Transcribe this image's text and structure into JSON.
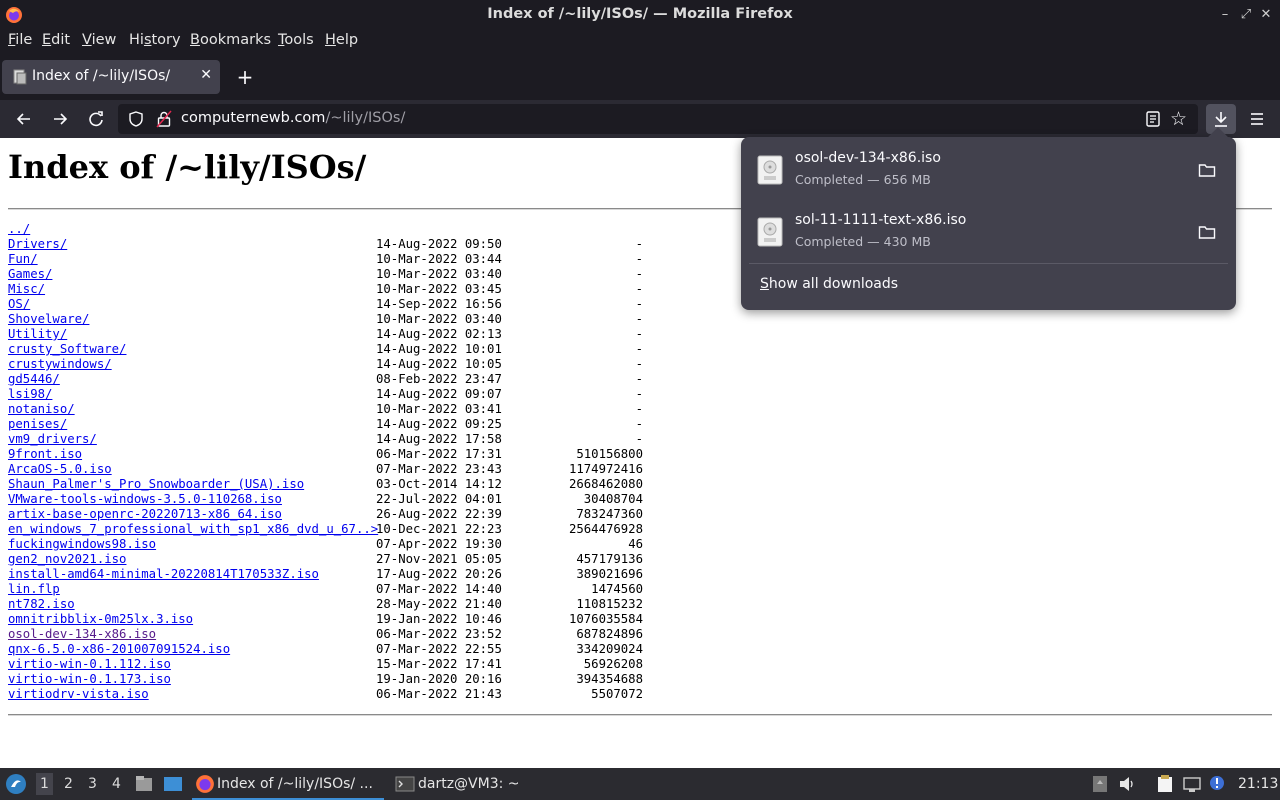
{
  "window": {
    "title": "Index of /~lily/ISOs/ — Mozilla Firefox"
  },
  "menubar": [
    {
      "label": "File",
      "accel": "F",
      "rest": "ile"
    },
    {
      "label": "Edit",
      "accel": "E",
      "rest": "dit"
    },
    {
      "label": "View",
      "accel": "V",
      "rest": "iew"
    },
    {
      "label": "History",
      "accel": "s",
      "pre": "Hi",
      "rest": "tory"
    },
    {
      "label": "Bookmarks",
      "accel": "B",
      "rest": "ookmarks"
    },
    {
      "label": "Tools",
      "accel": "T",
      "rest": "ools"
    },
    {
      "label": "Help",
      "accel": "H",
      "rest": "elp"
    }
  ],
  "tab": {
    "title": "Index of /~lily/ISOs/",
    "close": "✕"
  },
  "newtab": "+",
  "urlbar": {
    "host": "computernewb.com",
    "path": "/~lily/ISOs/"
  },
  "page": {
    "heading": "Index of /~lily/ISOs/",
    "parent": "../",
    "entries": [
      {
        "name": "Drivers/",
        "date": "14-Aug-2022 09:50",
        "size": "-"
      },
      {
        "name": "Fun/",
        "date": "10-Mar-2022 03:44",
        "size": "-"
      },
      {
        "name": "Games/",
        "date": "10-Mar-2022 03:40",
        "size": "-"
      },
      {
        "name": "Misc/",
        "date": "10-Mar-2022 03:45",
        "size": "-"
      },
      {
        "name": "OS/",
        "date": "14-Sep-2022 16:56",
        "size": "-"
      },
      {
        "name": "Shovelware/",
        "date": "10-Mar-2022 03:40",
        "size": "-"
      },
      {
        "name": "Utility/",
        "date": "14-Aug-2022 02:13",
        "size": "-"
      },
      {
        "name": "crusty_Software/",
        "date": "14-Aug-2022 10:01",
        "size": "-"
      },
      {
        "name": "crustywindows/",
        "date": "14-Aug-2022 10:05",
        "size": "-"
      },
      {
        "name": "gd5446/",
        "date": "08-Feb-2022 23:47",
        "size": "-"
      },
      {
        "name": "lsi98/",
        "date": "14-Aug-2022 09:07",
        "size": "-"
      },
      {
        "name": "notaniso/",
        "date": "10-Mar-2022 03:41",
        "size": "-"
      },
      {
        "name": "penises/",
        "date": "14-Aug-2022 09:25",
        "size": "-"
      },
      {
        "name": "vm9_drivers/",
        "date": "14-Aug-2022 17:58",
        "size": "-"
      },
      {
        "name": "9front.iso",
        "date": "06-Mar-2022 17:31",
        "size": "510156800"
      },
      {
        "name": "ArcaOS-5.0.iso",
        "date": "07-Mar-2022 23:43",
        "size": "1174972416"
      },
      {
        "name": "Shaun_Palmer's_Pro_Snowboarder_(USA).iso",
        "date": "03-Oct-2014 14:12",
        "size": "2668462080"
      },
      {
        "name": "VMware-tools-windows-3.5.0-110268.iso",
        "date": "22-Jul-2022 04:01",
        "size": "30408704"
      },
      {
        "name": "artix-base-openrc-20220713-x86_64.iso",
        "date": "26-Aug-2022 22:39",
        "size": "783247360"
      },
      {
        "name": "en_windows_7_professional_with_sp1_x86_dvd_u_67..>",
        "date": "10-Dec-2021 22:23",
        "size": "2564476928"
      },
      {
        "name": "fuckingwindows98.iso",
        "date": "07-Apr-2022 19:30",
        "size": "46"
      },
      {
        "name": "gen2_nov2021.iso",
        "date": "27-Nov-2021 05:05",
        "size": "457179136"
      },
      {
        "name": "install-amd64-minimal-20220814T170533Z.iso",
        "date": "17-Aug-2022 20:26",
        "size": "389021696"
      },
      {
        "name": "lin.flp",
        "date": "07-Mar-2022 14:40",
        "size": "1474560"
      },
      {
        "name": "nt782.iso",
        "date": "28-May-2022 21:40",
        "size": "110815232"
      },
      {
        "name": "omnitribblix-0m25lx.3.iso",
        "date": "19-Jan-2022 10:46",
        "size": "1076035584"
      },
      {
        "name": "osol-dev-134-x86.iso",
        "date": "06-Mar-2022 23:52",
        "size": "687824896",
        "visited": true
      },
      {
        "name": "qnx-6.5.0-x86-201007091524.iso",
        "date": "07-Mar-2022 22:55",
        "size": "334209024"
      },
      {
        "name": "virtio-win-0.1.112.iso",
        "date": "15-Mar-2022 17:41",
        "size": "56926208"
      },
      {
        "name": "virtio-win-0.1.173.iso",
        "date": "19-Jan-2020 20:16",
        "size": "394354688"
      },
      {
        "name": "virtiodrv-vista.iso",
        "date": "06-Mar-2022 21:43",
        "size": "5507072"
      }
    ]
  },
  "downloads": {
    "items": [
      {
        "name": "osol-dev-134-x86.iso",
        "status": "Completed — 656 MB"
      },
      {
        "name": "sol-11-1111-text-x86.iso",
        "status": "Completed — 430 MB"
      }
    ],
    "show_all_accel": "S",
    "show_all_rest": "how all downloads"
  },
  "taskbar": {
    "workspaces": [
      "1",
      "2",
      "3",
      "4"
    ],
    "tasks": [
      {
        "label": "Index of /~lily/ISOs/ ..."
      },
      {
        "label": "dartz@VM3: ~"
      }
    ],
    "clock": "21:13"
  },
  "icons": {
    "app": "firefox-icon",
    "favicon": "page-favicon-icon",
    "iso_file": "iso-file-icon",
    "folder": "folder-icon"
  },
  "colors": {
    "chrome_dark": "#1c1b22",
    "toolbar": "#2b2a33",
    "tab_active": "#42414d",
    "link": "#0000ee",
    "link_visited": "#551a8b",
    "accent": "#3d8fd6"
  }
}
